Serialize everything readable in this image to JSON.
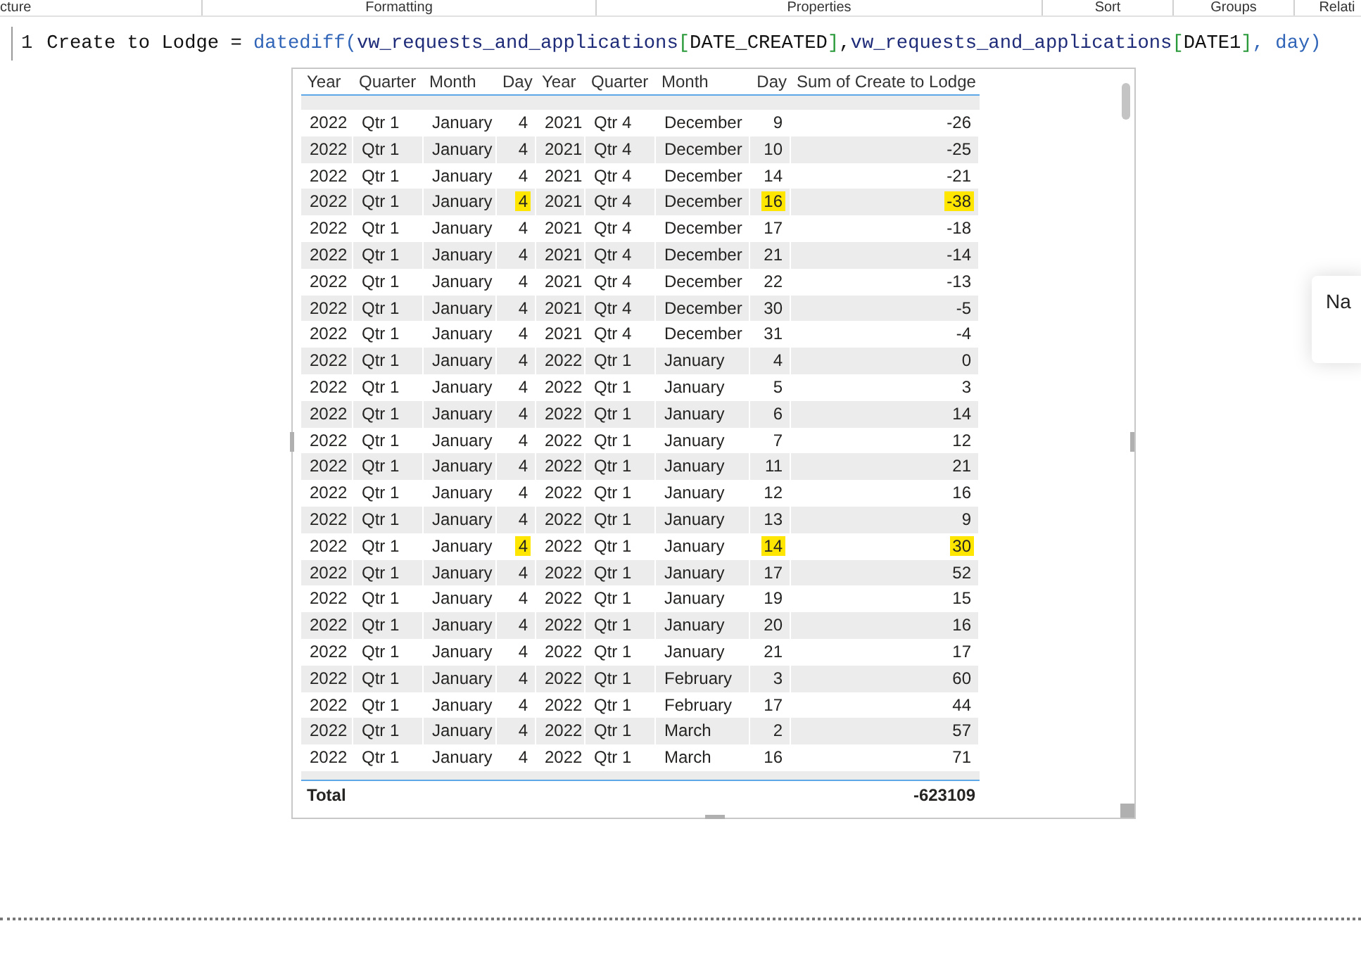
{
  "ribbon_tabs": [
    "cture",
    "Formatting",
    "Properties",
    "Sort",
    "Groups",
    "Relati"
  ],
  "formula": {
    "line_number": "1",
    "segments": [
      {
        "kind": "plain",
        "text": "Create to Lodge = "
      },
      {
        "kind": "function",
        "text": "datediff("
      },
      {
        "kind": "table",
        "text": "vw_requests_and_applications"
      },
      {
        "kind": "bracket",
        "text": "["
      },
      {
        "kind": "plain",
        "text": "DATE_CREATED"
      },
      {
        "kind": "bracket",
        "text": "]"
      },
      {
        "kind": "plain",
        "text": ","
      },
      {
        "kind": "table",
        "text": "vw_requests_and_applications"
      },
      {
        "kind": "bracket",
        "text": "["
      },
      {
        "kind": "plain",
        "text": "DATE1"
      },
      {
        "kind": "bracket",
        "text": "]"
      },
      {
        "kind": "function",
        "text": ", day)"
      }
    ]
  },
  "table": {
    "columns": [
      "Year",
      "Quarter",
      "Month",
      "Day",
      "Year",
      "Quarter",
      "Month",
      "Day",
      "Sum of Create to Lodge"
    ],
    "rows": [
      {
        "cells": [
          "2022",
          "Qtr 1",
          "January",
          "4",
          "2021",
          "Qtr 4",
          "December",
          "9",
          "-26"
        ],
        "highlighted": false
      },
      {
        "cells": [
          "2022",
          "Qtr 1",
          "January",
          "4",
          "2021",
          "Qtr 4",
          "December",
          "10",
          "-25"
        ],
        "highlighted": false
      },
      {
        "cells": [
          "2022",
          "Qtr 1",
          "January",
          "4",
          "2021",
          "Qtr 4",
          "December",
          "14",
          "-21"
        ],
        "highlighted": false
      },
      {
        "cells": [
          "2022",
          "Qtr 1",
          "January",
          "4",
          "2021",
          "Qtr 4",
          "December",
          "16",
          "-38"
        ],
        "highlighted": true
      },
      {
        "cells": [
          "2022",
          "Qtr 1",
          "January",
          "4",
          "2021",
          "Qtr 4",
          "December",
          "17",
          "-18"
        ],
        "highlighted": false
      },
      {
        "cells": [
          "2022",
          "Qtr 1",
          "January",
          "4",
          "2021",
          "Qtr 4",
          "December",
          "21",
          "-14"
        ],
        "highlighted": false
      },
      {
        "cells": [
          "2022",
          "Qtr 1",
          "January",
          "4",
          "2021",
          "Qtr 4",
          "December",
          "22",
          "-13"
        ],
        "highlighted": false
      },
      {
        "cells": [
          "2022",
          "Qtr 1",
          "January",
          "4",
          "2021",
          "Qtr 4",
          "December",
          "30",
          "-5"
        ],
        "highlighted": false
      },
      {
        "cells": [
          "2022",
          "Qtr 1",
          "January",
          "4",
          "2021",
          "Qtr 4",
          "December",
          "31",
          "-4"
        ],
        "highlighted": false
      },
      {
        "cells": [
          "2022",
          "Qtr 1",
          "January",
          "4",
          "2022",
          "Qtr 1",
          "January",
          "4",
          "0"
        ],
        "highlighted": false
      },
      {
        "cells": [
          "2022",
          "Qtr 1",
          "January",
          "4",
          "2022",
          "Qtr 1",
          "January",
          "5",
          "3"
        ],
        "highlighted": false
      },
      {
        "cells": [
          "2022",
          "Qtr 1",
          "January",
          "4",
          "2022",
          "Qtr 1",
          "January",
          "6",
          "14"
        ],
        "highlighted": false
      },
      {
        "cells": [
          "2022",
          "Qtr 1",
          "January",
          "4",
          "2022",
          "Qtr 1",
          "January",
          "7",
          "12"
        ],
        "highlighted": false
      },
      {
        "cells": [
          "2022",
          "Qtr 1",
          "January",
          "4",
          "2022",
          "Qtr 1",
          "January",
          "11",
          "21"
        ],
        "highlighted": false
      },
      {
        "cells": [
          "2022",
          "Qtr 1",
          "January",
          "4",
          "2022",
          "Qtr 1",
          "January",
          "12",
          "16"
        ],
        "highlighted": false
      },
      {
        "cells": [
          "2022",
          "Qtr 1",
          "January",
          "4",
          "2022",
          "Qtr 1",
          "January",
          "13",
          "9"
        ],
        "highlighted": false
      },
      {
        "cells": [
          "2022",
          "Qtr 1",
          "January",
          "4",
          "2022",
          "Qtr 1",
          "January",
          "14",
          "30"
        ],
        "highlighted": true
      },
      {
        "cells": [
          "2022",
          "Qtr 1",
          "January",
          "4",
          "2022",
          "Qtr 1",
          "January",
          "17",
          "52"
        ],
        "highlighted": false
      },
      {
        "cells": [
          "2022",
          "Qtr 1",
          "January",
          "4",
          "2022",
          "Qtr 1",
          "January",
          "19",
          "15"
        ],
        "highlighted": false
      },
      {
        "cells": [
          "2022",
          "Qtr 1",
          "January",
          "4",
          "2022",
          "Qtr 1",
          "January",
          "20",
          "16"
        ],
        "highlighted": false
      },
      {
        "cells": [
          "2022",
          "Qtr 1",
          "January",
          "4",
          "2022",
          "Qtr 1",
          "January",
          "21",
          "17"
        ],
        "highlighted": false
      },
      {
        "cells": [
          "2022",
          "Qtr 1",
          "January",
          "4",
          "2022",
          "Qtr 1",
          "February",
          "3",
          "60"
        ],
        "highlighted": false
      },
      {
        "cells": [
          "2022",
          "Qtr 1",
          "January",
          "4",
          "2022",
          "Qtr 1",
          "February",
          "17",
          "44"
        ],
        "highlighted": false
      },
      {
        "cells": [
          "2022",
          "Qtr 1",
          "January",
          "4",
          "2022",
          "Qtr 1",
          "March",
          "2",
          "57"
        ],
        "highlighted": false
      },
      {
        "cells": [
          "2022",
          "Qtr 1",
          "January",
          "4",
          "2022",
          "Qtr 1",
          "March",
          "16",
          "71"
        ],
        "highlighted": false
      }
    ],
    "total": {
      "label": "Total",
      "value": "-623109"
    }
  },
  "side_card": {
    "text": "Na"
  }
}
